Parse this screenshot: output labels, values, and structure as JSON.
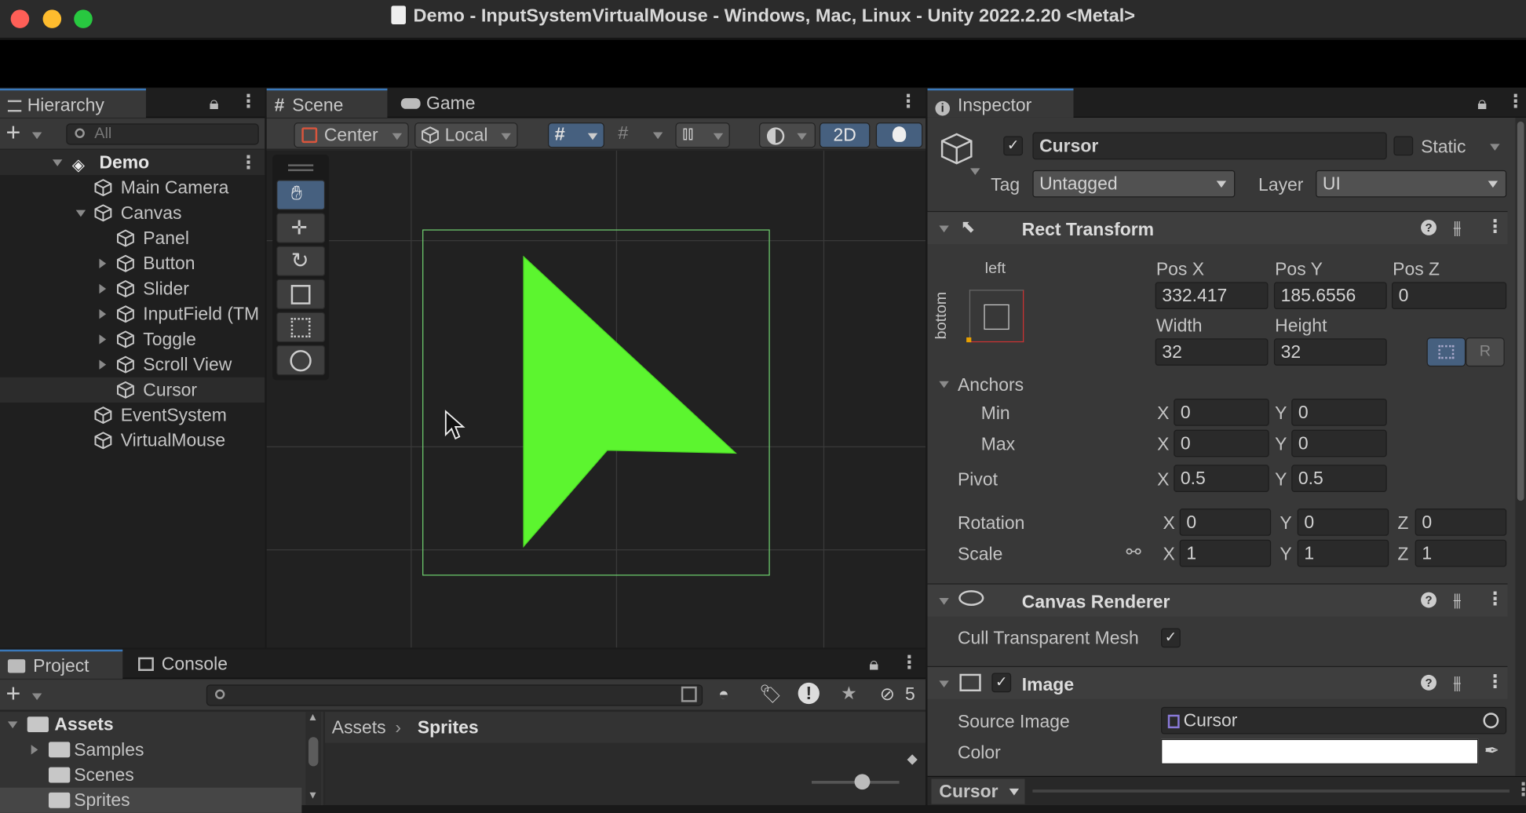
{
  "window": {
    "title": "Demo - InputSystemVirtualMouse - Windows, Mac, Linux - Unity 2022.2.20 <Metal>"
  },
  "colors": {
    "accent": "#3a79bb",
    "cursor_sprite": "#5cf52f",
    "rect_outline": "#6fcf6f"
  },
  "hierarchy": {
    "tab_label": "Hierarchy",
    "search_placeholder": "All",
    "scene_name": "Demo",
    "items": [
      {
        "label": "Main Camera"
      },
      {
        "label": "Canvas"
      },
      {
        "label": "Panel"
      },
      {
        "label": "Button"
      },
      {
        "label": "Slider"
      },
      {
        "label": "InputField (TM"
      },
      {
        "label": "Toggle"
      },
      {
        "label": "Scroll View"
      },
      {
        "label": "Cursor"
      },
      {
        "label": "EventSystem"
      },
      {
        "label": "VirtualMouse"
      }
    ]
  },
  "scene_view": {
    "tabs": [
      {
        "label": "Scene"
      },
      {
        "label": "Game"
      }
    ],
    "pivot_label": "Center",
    "space_label": "Local",
    "mode_2d": "2D"
  },
  "inspector": {
    "tab_label": "Inspector",
    "object_name": "Cursor",
    "static_label": "Static",
    "tag_label": "Tag",
    "tag_value": "Untagged",
    "layer_label": "Layer",
    "layer_value": "UI",
    "rect_transform": {
      "title": "Rect Transform",
      "anchor_h": "left",
      "anchor_v": "bottom",
      "pos_x_label": "Pos X",
      "pos_y_label": "Pos Y",
      "pos_z_label": "Pos Z",
      "pos_x": "332.417",
      "pos_y": "185.6556",
      "pos_z": "0",
      "width_label": "Width",
      "height_label": "Height",
      "width": "32",
      "height": "32",
      "r_button": "R",
      "anchors_label": "Anchors",
      "min_label": "Min",
      "max_label": "Max",
      "min_x": "0",
      "min_y": "0",
      "max_x": "0",
      "max_y": "0",
      "pivot_label": "Pivot",
      "pivot_x": "0.5",
      "pivot_y": "0.5",
      "rotation_label": "Rotation",
      "rot_x": "0",
      "rot_y": "0",
      "rot_z": "0",
      "scale_label": "Scale",
      "scale_x": "1",
      "scale_y": "1",
      "scale_z": "1",
      "x": "X",
      "y": "Y",
      "z": "Z"
    },
    "canvas_renderer": {
      "title": "Canvas Renderer",
      "cull_label": "Cull Transparent Mesh"
    },
    "image": {
      "title": "Image",
      "source_label": "Source Image",
      "source_value": "Cursor",
      "color_label": "Color"
    },
    "footer_label": "Cursor"
  },
  "project": {
    "tabs": [
      {
        "label": "Project"
      },
      {
        "label": "Console"
      }
    ],
    "hidden_count": "5",
    "tree": [
      {
        "label": "Assets"
      },
      {
        "label": "Samples"
      },
      {
        "label": "Scenes"
      },
      {
        "label": "Sprites"
      }
    ],
    "breadcrumb": [
      "Assets",
      "Sprites"
    ]
  }
}
